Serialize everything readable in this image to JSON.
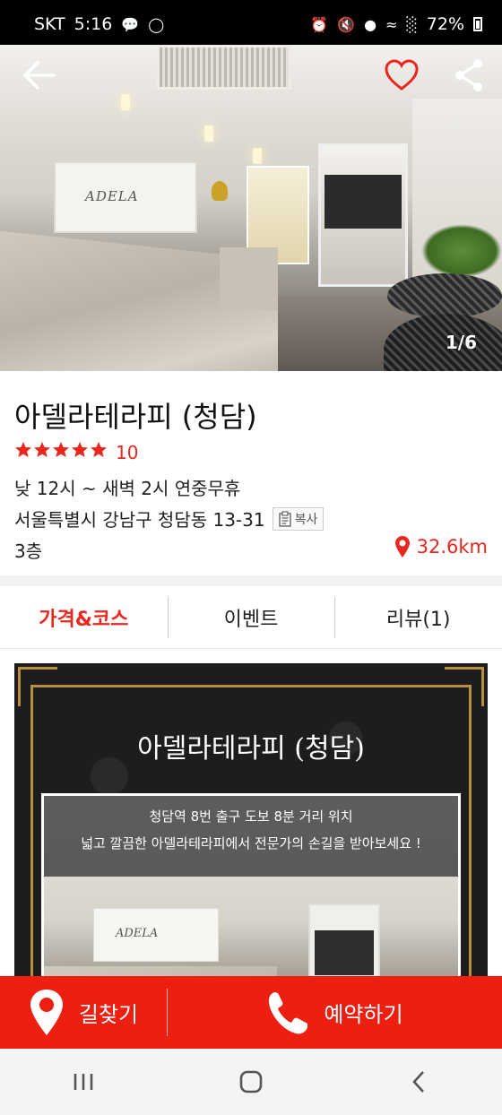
{
  "status_bar": {
    "carrier": "SKT",
    "time": "5:16",
    "battery": "72%",
    "icons": [
      "talk-icon",
      "instagram-icon",
      "alarm-icon",
      "mute-icon",
      "location-icon",
      "wifi-icon",
      "signal-icon",
      "battery-icon"
    ]
  },
  "hero": {
    "image_counter": "1/6",
    "logo_text": "ADELA",
    "icons": {
      "back": "back-arrow-icon",
      "favorite": "heart-icon",
      "share": "share-icon"
    },
    "favorite_color": "#e8271f"
  },
  "shop": {
    "name": "아델라테라피 (청담)",
    "star_count": 5,
    "rating_count": "10",
    "hours": "낮 12시 ~ 새벽 2시 연중무휴",
    "address": "서울특별시 강남구 청담동 13-31",
    "copy_label": "복사",
    "floor": "3층",
    "distance": "32.6km"
  },
  "tabs": [
    {
      "label": "가격&코스",
      "active": true
    },
    {
      "label": "이벤트",
      "active": false
    },
    {
      "label": "리뷰(1)",
      "active": false
    }
  ],
  "promo": {
    "title": "아델라테라피 (청담)",
    "caption_line1": "청담역 8번 출구 도보 8분 거리 위치",
    "caption_line2": "넓고 깔끔한 아델라테라피에서 전문가의 손길을 받아보세요 !",
    "logo_text": "ADELA"
  },
  "actions": {
    "directions_label": "길찾기",
    "book_label": "예약하기"
  },
  "colors": {
    "accent": "#e8271f",
    "action_bar": "#ee1e10",
    "gold": "#b98f3f"
  }
}
